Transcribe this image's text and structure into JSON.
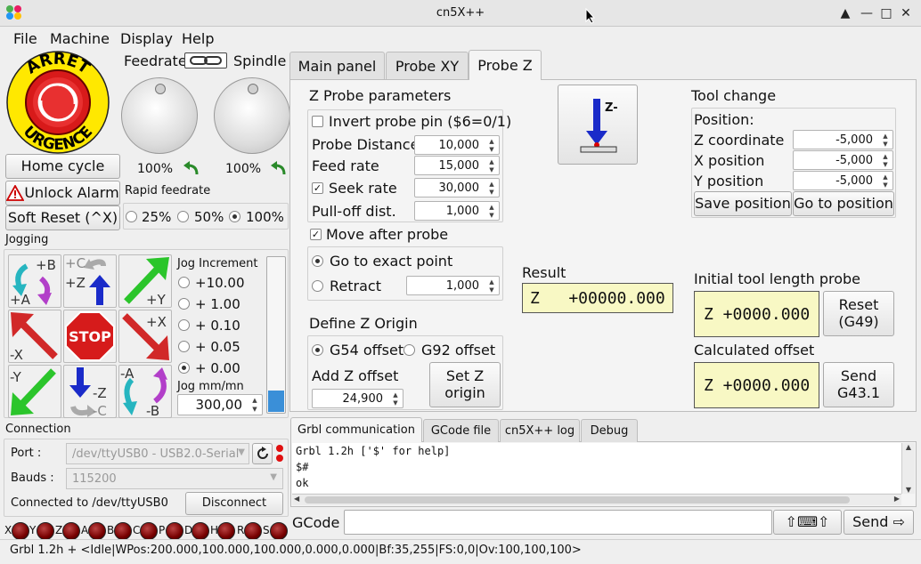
{
  "window": {
    "title": "cn5X++",
    "controls": [
      "▲",
      "—",
      "□",
      "✕"
    ]
  },
  "menu": [
    "File",
    "Machine",
    "Display",
    "Help"
  ],
  "left": {
    "estop_top": "ARRET",
    "estop_bottom": "URGENCE",
    "feedrate_label": "Feedrate",
    "spindle_label": "Spindle",
    "feedrate_value": "100%",
    "spindle_value": "100%",
    "home_cycle": "Home cycle",
    "unlock_alarm": "Unlock Alarm",
    "soft_reset": "Soft Reset (^X)",
    "rapid_label": "Rapid feedrate",
    "rapid_options": [
      "25%",
      "50%",
      "100%"
    ],
    "rapid_selected": 2,
    "jogging_label": "Jogging",
    "jog_buttons": {
      "b_plus_a": [
        "+B",
        "+A"
      ],
      "c_plus_z": [
        "+C",
        "+Z"
      ],
      "plus_y": "+Y",
      "minus_x": "-X",
      "stop": "STOP",
      "plus_x": "+X",
      "minus_y": "-Y",
      "minus_z_c": [
        "-Z",
        "-C"
      ],
      "minus_a_b": [
        "-A",
        "-B"
      ]
    },
    "jog_increment_label": "Jog Increment",
    "increments": [
      "+10.00",
      "+ 1.00",
      "+ 0.10",
      "+ 0.05",
      "+ 0.00"
    ],
    "increment_selected": 4,
    "jog_speed_label": "Jog mm/mn",
    "jog_speed": "300,00",
    "connection_label": "Connection",
    "port_label": "Port :",
    "port_value": "/dev/ttyUSB0 - USB2.0-Serial",
    "bauds_label": "Bauds :",
    "bauds_value": "115200",
    "connected_text": "Connected to /dev/ttyUSB0",
    "disconnect": "Disconnect",
    "leds": [
      "X",
      "Y",
      "Z",
      "A",
      "B",
      "C",
      "P",
      "D",
      "H",
      "R",
      "S"
    ]
  },
  "tabs": [
    "Main panel",
    "Probe XY",
    "Probe Z"
  ],
  "active_tab": 2,
  "probe": {
    "params_title": "Z Probe parameters",
    "invert_label": "Invert probe pin ($6=0/1)",
    "invert_checked": false,
    "probe_distance_label": "Probe Distance",
    "probe_distance": "10,000",
    "feed_rate_label": "Feed rate",
    "feed_rate": "15,000",
    "seek_rate_label": "Seek rate",
    "seek_rate": "30,000",
    "seek_checked": true,
    "pulloff_label": "Pull-off dist.",
    "pulloff": "1,000",
    "move_after_label": "Move after probe",
    "move_after_checked": true,
    "exact_point_label": "Go to exact point",
    "retract_label": "Retract",
    "retract": "1,000",
    "define_origin_title": "Define Z Origin",
    "g54_label": "G54 offset",
    "g92_label": "G92 offset",
    "add_offset_label": "Add Z offset",
    "add_offset": "24,900",
    "set_origin": "Set Z origin",
    "icon_label": "Z-",
    "result_label": "Result",
    "result_value": "Z   +00000.000",
    "tool_change_title": "Tool change",
    "position_label": "Position:",
    "z_coord_label": "Z coordinate",
    "z_coord": "-5,000",
    "x_pos_label": "X position",
    "x_pos": "-5,000",
    "y_pos_label": "Y position",
    "y_pos": "-5,000",
    "save_position": "Save position",
    "go_position": "Go to position",
    "initial_probe_label": "Initial tool length probe",
    "initial_value": "Z +0000.000",
    "reset_label": "Reset (G49)",
    "calc_offset_label": "Calculated offset",
    "calc_value": "Z +0000.000",
    "send_label": "Send G43.1"
  },
  "bottom_tabs": [
    "Grbl communication",
    "GCode file",
    "cn5X++ log",
    "Debug"
  ],
  "bottom_active": 0,
  "console": [
    "Grbl 1.2h ['$' for help]",
    "$#",
    "ok"
  ],
  "gcode_label": "GCode :",
  "gcode_value": "",
  "kbd_button": "⇧⌨⇧",
  "send_button": "Send ⇨",
  "status_bar": "Grbl 1.2h  + <Idle|WPos:200.000,100.000,100.000,0.000,0.000|Bf:35,255|FS:0,0|Ov:100,100,100>"
}
